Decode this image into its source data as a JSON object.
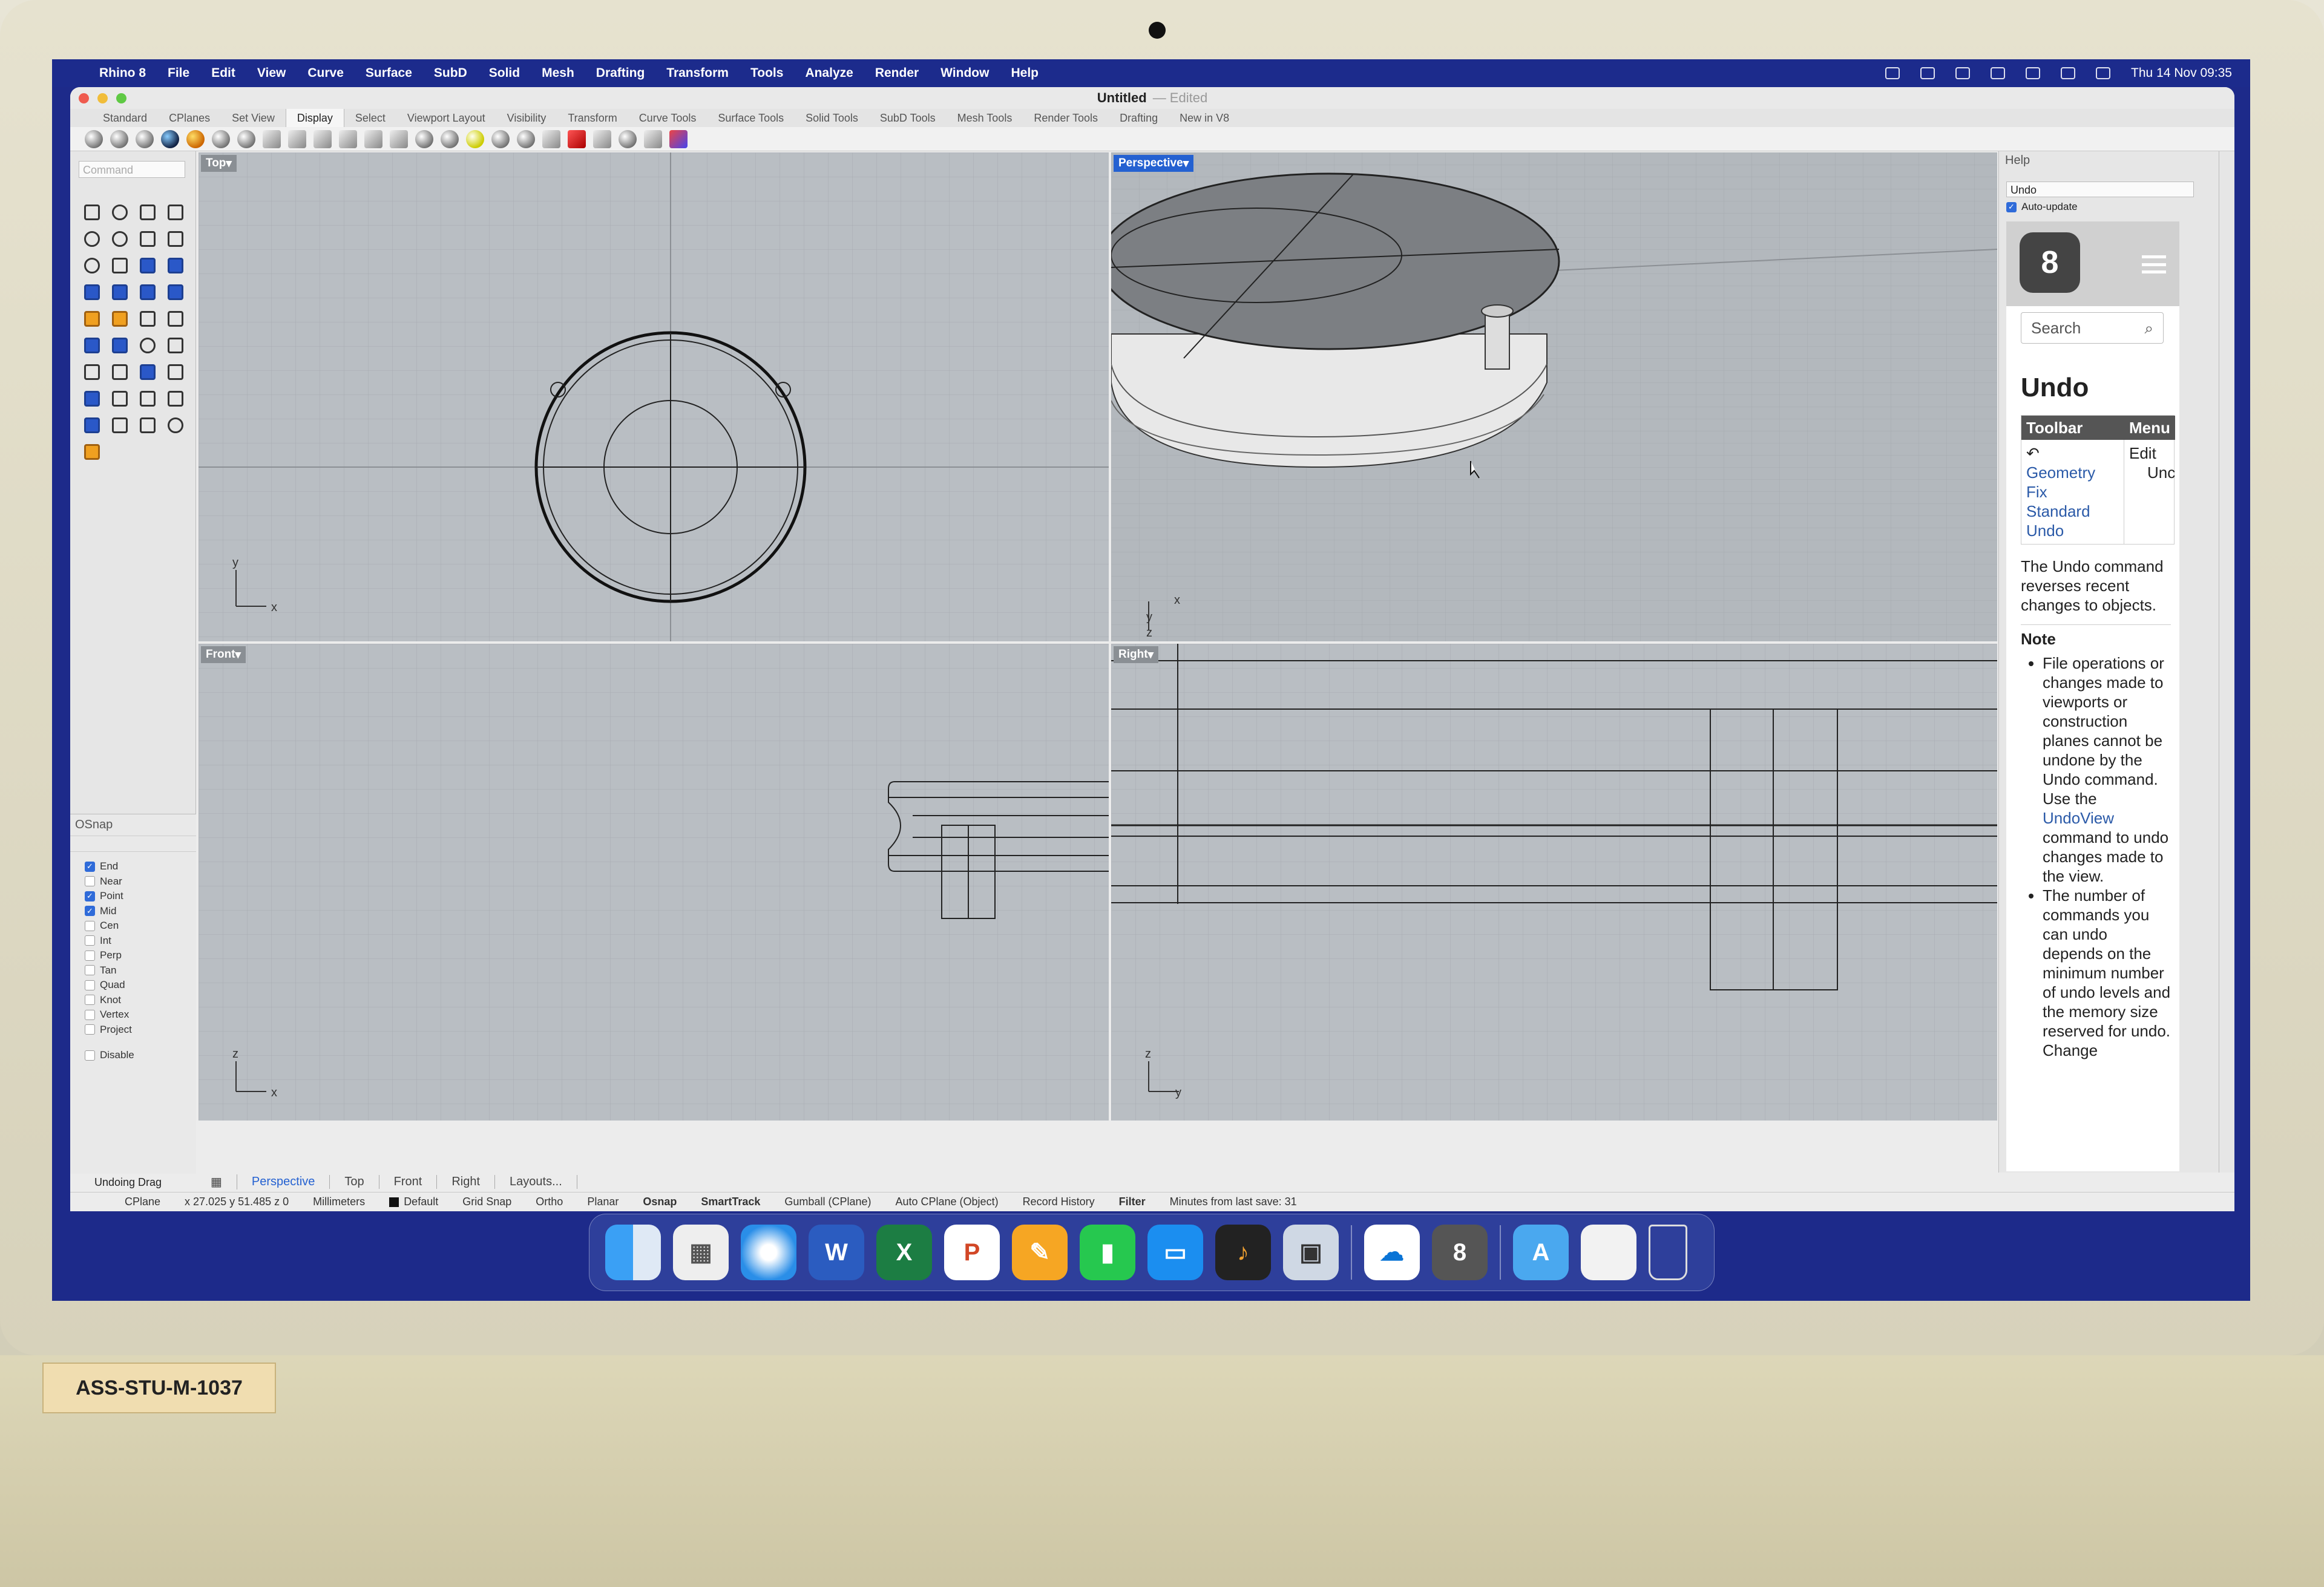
{
  "asset_tag": "ASS-STU-M-1037",
  "menubar": {
    "app": "Rhino 8",
    "items": [
      "File",
      "Edit",
      "View",
      "Curve",
      "Surface",
      "SubD",
      "Solid",
      "Mesh",
      "Drafting",
      "Transform",
      "Tools",
      "Analyze",
      "Render",
      "Window",
      "Help"
    ],
    "clock": "Thu 14 Nov 09:35"
  },
  "window": {
    "title": "Untitled",
    "edited": "— Edited"
  },
  "toolbar_tabs": [
    "Standard",
    "CPlanes",
    "Set View",
    "Display",
    "Select",
    "Viewport Layout",
    "Visibility",
    "Transform",
    "Curve Tools",
    "Surface Tools",
    "Solid Tools",
    "SubD Tools",
    "Mesh Tools",
    "Render Tools",
    "Drafting",
    "New in V8"
  ],
  "active_tab": "Display",
  "command_placeholder": "Command",
  "viewports": {
    "top": "Top",
    "perspective": "Perspective",
    "front": "Front",
    "right": "Right"
  },
  "osnap": {
    "title": "OSnap",
    "items": [
      {
        "label": "End",
        "checked": true
      },
      {
        "label": "Near",
        "checked": false
      },
      {
        "label": "Point",
        "checked": true
      },
      {
        "label": "Mid",
        "checked": true
      },
      {
        "label": "Cen",
        "checked": false
      },
      {
        "label": "Int",
        "checked": false
      },
      {
        "label": "Perp",
        "checked": false
      },
      {
        "label": "Tan",
        "checked": false
      },
      {
        "label": "Quad",
        "checked": false
      },
      {
        "label": "Knot",
        "checked": false
      },
      {
        "label": "Vertex",
        "checked": false
      },
      {
        "label": "Project",
        "checked": false
      }
    ],
    "disable": "Disable"
  },
  "view_tabs": [
    "Perspective",
    "Top",
    "Front",
    "Right",
    "Layouts..."
  ],
  "history_text": "Undoing Drag",
  "status": {
    "cplane": "CPlane",
    "coords": "x 27.025  y 51.485  z 0",
    "units": "Millimeters",
    "layer": "Default",
    "toggles": [
      "Grid Snap",
      "Ortho",
      "Planar",
      "Osnap",
      "SmartTrack",
      "Gumball (CPlane)",
      "Auto CPlane (Object)",
      "Record History",
      "Filter"
    ],
    "save": "Minutes from last save: 31"
  },
  "help": {
    "panel_title": "Help",
    "field": "Undo",
    "auto_update": "Auto-update",
    "search": "Search",
    "heading": "Undo",
    "col_toolbar": "Toolbar",
    "col_menu": "Menu",
    "toolbar_links": [
      "Geometry Fix",
      "Standard",
      "Undo"
    ],
    "menu_values": [
      "Edit",
      "Unc"
    ],
    "description": "The Undo command reverses recent changes to objects.",
    "note_heading": "Note",
    "note1_a": "File operations or changes made to viewports or construction planes cannot be undone by the Undo command. Use the ",
    "note1_link": "UndoView",
    "note1_b": " command to undo changes made to the view.",
    "note2": "The number of commands you can undo depends on the minimum number of undo levels and the memory size reserved for undo. Change"
  },
  "axes": {
    "x": "x",
    "y": "y",
    "z": "z"
  },
  "dock": [
    "Finder",
    "Launchpad",
    "Safari",
    "Word",
    "Excel",
    "PowerPoint",
    "Pages",
    "Numbers",
    "Keynote",
    "GarageBand",
    "Preview",
    "OneDrive",
    "Rhino 8",
    "Applications",
    "Documents",
    "Trash"
  ]
}
